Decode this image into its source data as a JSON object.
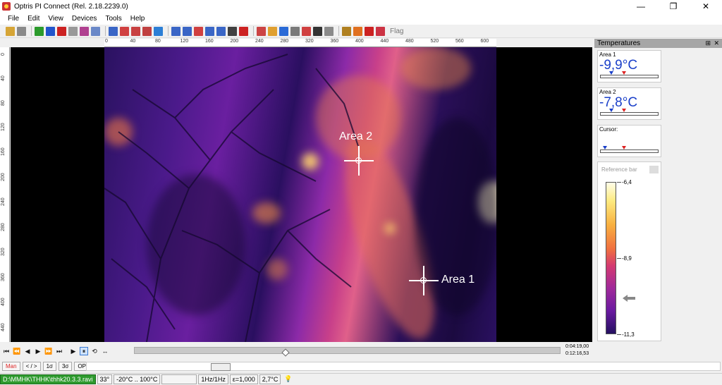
{
  "window": {
    "title": "Optris PI Connect (Rel. 2.18.2239.0)",
    "controls": [
      "—",
      "❐",
      "✕"
    ]
  },
  "menu": [
    "File",
    "Edit",
    "View",
    "Devices",
    "Tools",
    "Help"
  ],
  "toolbar": {
    "flag_label": "Flag",
    "icons": [
      "open-icon",
      "save-icon",
      "play-icon",
      "pause-icon",
      "stop-icon",
      "record-icon",
      "camera-icon",
      "copy-icon",
      "layout-1-icon",
      "layout-2-icon",
      "layout-3-icon",
      "layout-4-icon",
      "layout-5-icon",
      "histogram-icon",
      "chart-icon",
      "profile-icon",
      "trend-icon",
      "graph-icon",
      "grid-icon",
      "table-icon",
      "temperature-icon",
      "hand-icon",
      "crosshair-icon",
      "palette-icon",
      "colorbar-icon",
      "tools-icon",
      "settings-icon",
      "calibrate-icon",
      "fire-icon",
      "alarm-icon",
      "flag-icon"
    ],
    "icon_colors": [
      "#d6a536",
      "#8a8a8a",
      "#2c9b2c",
      "#2255cc",
      "#cc2222",
      "#999999",
      "#b04090",
      "#6a88c8",
      "#3a66c6",
      "#d04040",
      "#c84040",
      "#c04040",
      "#2c7fd6",
      "#3a66c6",
      "#3a66c6",
      "#d04040",
      "#3a66c6",
      "#3a66c6",
      "#404040",
      "#cc2222",
      "#cc4444",
      "#e0a030",
      "#2a6ad6",
      "#7a7a7a",
      "#d04040",
      "#333333",
      "#8a8a8a",
      "#b08020",
      "#e07020",
      "#cc2222",
      "#cc3344"
    ]
  },
  "ruler": {
    "top": [
      "0",
      "40",
      "80",
      "120",
      "160",
      "200",
      "240",
      "280",
      "320",
      "360",
      "400",
      "440",
      "480",
      "520",
      "560",
      "600"
    ],
    "left": [
      "0",
      "40",
      "80",
      "120",
      "160",
      "200",
      "240",
      "280",
      "320",
      "360",
      "400",
      "440"
    ]
  },
  "markers": [
    {
      "name": "area-2-marker",
      "label": "Area 2"
    },
    {
      "name": "area-1-marker",
      "label": "Area 1"
    }
  ],
  "temperatures": {
    "title": "Temperatures",
    "pin": "⊞",
    "close": "✕",
    "area1": {
      "label": "Area 1",
      "value": "-9,9°C"
    },
    "area2": {
      "label": "Area 2",
      "value": "-7,8°C"
    },
    "cursor": {
      "label": "Cursor:",
      "value": ""
    }
  },
  "reference_bar": {
    "title": "Reference bar",
    "max": "-6,4",
    "mid": "-8,9",
    "min": "-11,3"
  },
  "playback": {
    "buttons": [
      "⏮",
      "⏪",
      "◀",
      "▶",
      "⏩",
      "⏭",
      "▶",
      "⏸"
    ],
    "time_current": "0:04:19,00",
    "time_total": "0:12:16,53",
    "position": 0.35
  },
  "low_controls": {
    "buttons": [
      "Man",
      "< / >",
      "1σ",
      "3σ",
      "OPT"
    ]
  },
  "status": {
    "file": "D:\\MMHK\\THHK\\thhk20.3.3.ravi",
    "fov": "33°",
    "range": "-20°C .. 100°C",
    "empty": "",
    "rate": "1Hz/1Hz",
    "emissivity": "ε=1,000",
    "ambient": "2,7°C"
  }
}
